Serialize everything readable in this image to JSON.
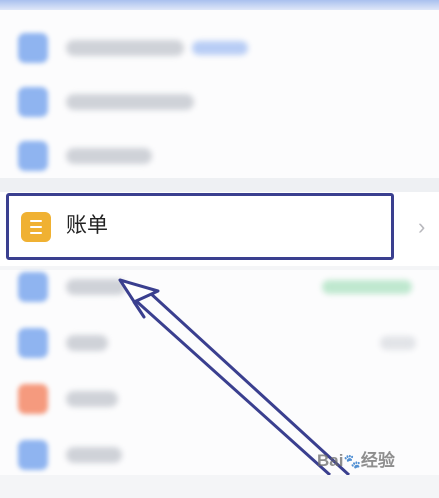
{
  "highlighted_item": {
    "label": "账单",
    "icon": "bill-icon",
    "icon_color": "#f0b132",
    "chevron": "›"
  },
  "annotation": {
    "frame_color": "#3a3f8f",
    "arrow_color": "#3a3f8f"
  },
  "watermark": {
    "brand_text": "Bai",
    "paw_glyph": "🐾",
    "suffix_text": "经验"
  },
  "colors": {
    "blurred_icon_blue": "#8fb4f0",
    "blurred_icon_orange": "#f59a7e",
    "blurred_tag_blue": "#b8cdf5",
    "blurred_tag_green": "#bfe8cf"
  }
}
